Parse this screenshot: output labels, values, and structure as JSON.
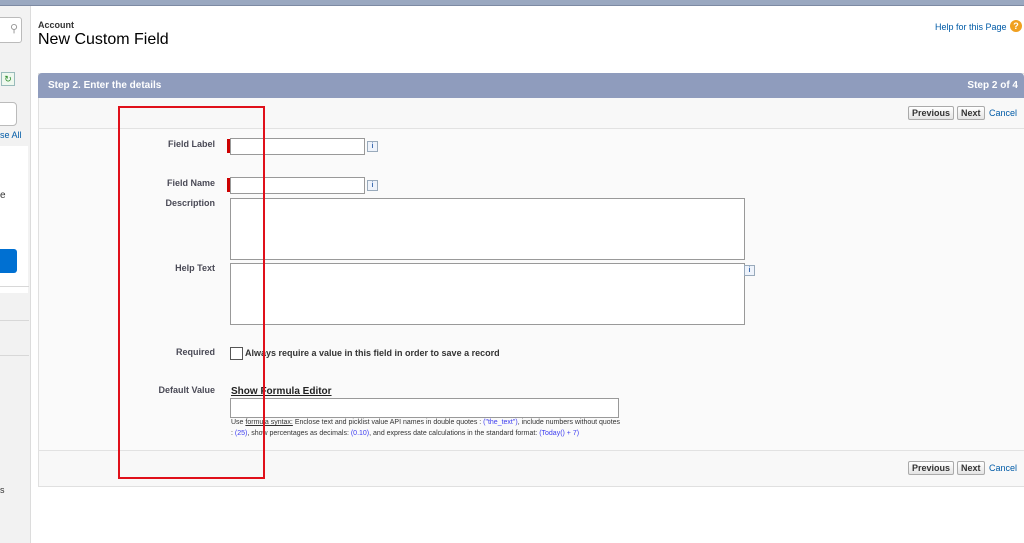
{
  "sidebar": {
    "link_fragment": "se All",
    "text_fragment_1": "e",
    "text_fragment_2": "s",
    "refresh_icon": "refresh-icon",
    "search_icon": "search-icon"
  },
  "header": {
    "object": "Account",
    "title": "New Custom Field",
    "help_link": "Help for this Page",
    "help_icon": "?"
  },
  "step": {
    "title": "Step 2. Enter the details",
    "progress": "Step 2 of 4"
  },
  "buttons": {
    "previous": "Previous",
    "next": "Next",
    "cancel": "Cancel"
  },
  "form": {
    "field_label": {
      "label": "Field Label",
      "value": ""
    },
    "field_name": {
      "label": "Field Name",
      "value": ""
    },
    "description": {
      "label": "Description",
      "value": ""
    },
    "help_text": {
      "label": "Help Text",
      "value": ""
    },
    "required": {
      "label": "Required",
      "checkbox_label": "Always require a value in this field in order to save a record",
      "checked": false
    },
    "default_value": {
      "label": "Default Value",
      "formula_link": "Show Formula Editor",
      "value": "",
      "hint": {
        "use": "Use ",
        "syntax_link": "formula syntax:",
        "p1": " Enclose text and picklist value API names in double quotes : ",
        "ex1": "(\"the_text\")",
        "p2": ", include numbers without quotes : ",
        "ex2": "(25)",
        "p3": ", show percentages as decimals: ",
        "ex3": "(0.10)",
        "p4": ", and express date calculations in the standard format: ",
        "ex4": "(Today() + 7)"
      }
    },
    "info_icon": "i"
  },
  "colors": {
    "step_bar": "#8f9cbd",
    "required_marker": "#cc0000",
    "annotation": "#e0101a",
    "link": "#015ba7"
  }
}
